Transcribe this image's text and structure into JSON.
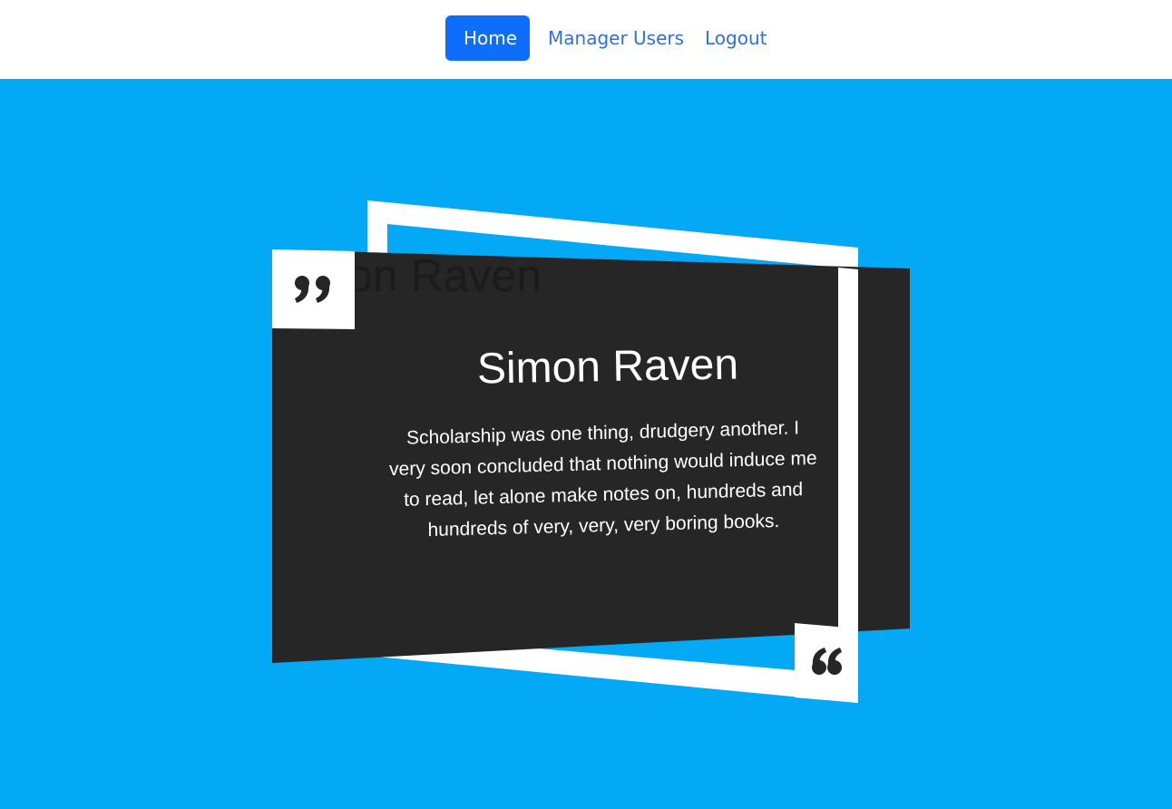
{
  "nav": {
    "items": [
      {
        "label": "Home",
        "active": true
      },
      {
        "label": "Manager Users",
        "active": false
      },
      {
        "label": "Logout",
        "active": false
      }
    ]
  },
  "hero": {
    "background_color": "#03a9f4",
    "card_color": "#262626",
    "frame_color": "#ffffff",
    "quote": {
      "author": "Simon Raven",
      "text": "Scholarship was one thing, drudgery another. I very soon concluded that nothing would induce me to read, let alone make notes on, hundreds and hundreds of very, very, very boring books.",
      "open_icon": "quote-close-icon",
      "close_icon": "quote-open-icon"
    }
  }
}
